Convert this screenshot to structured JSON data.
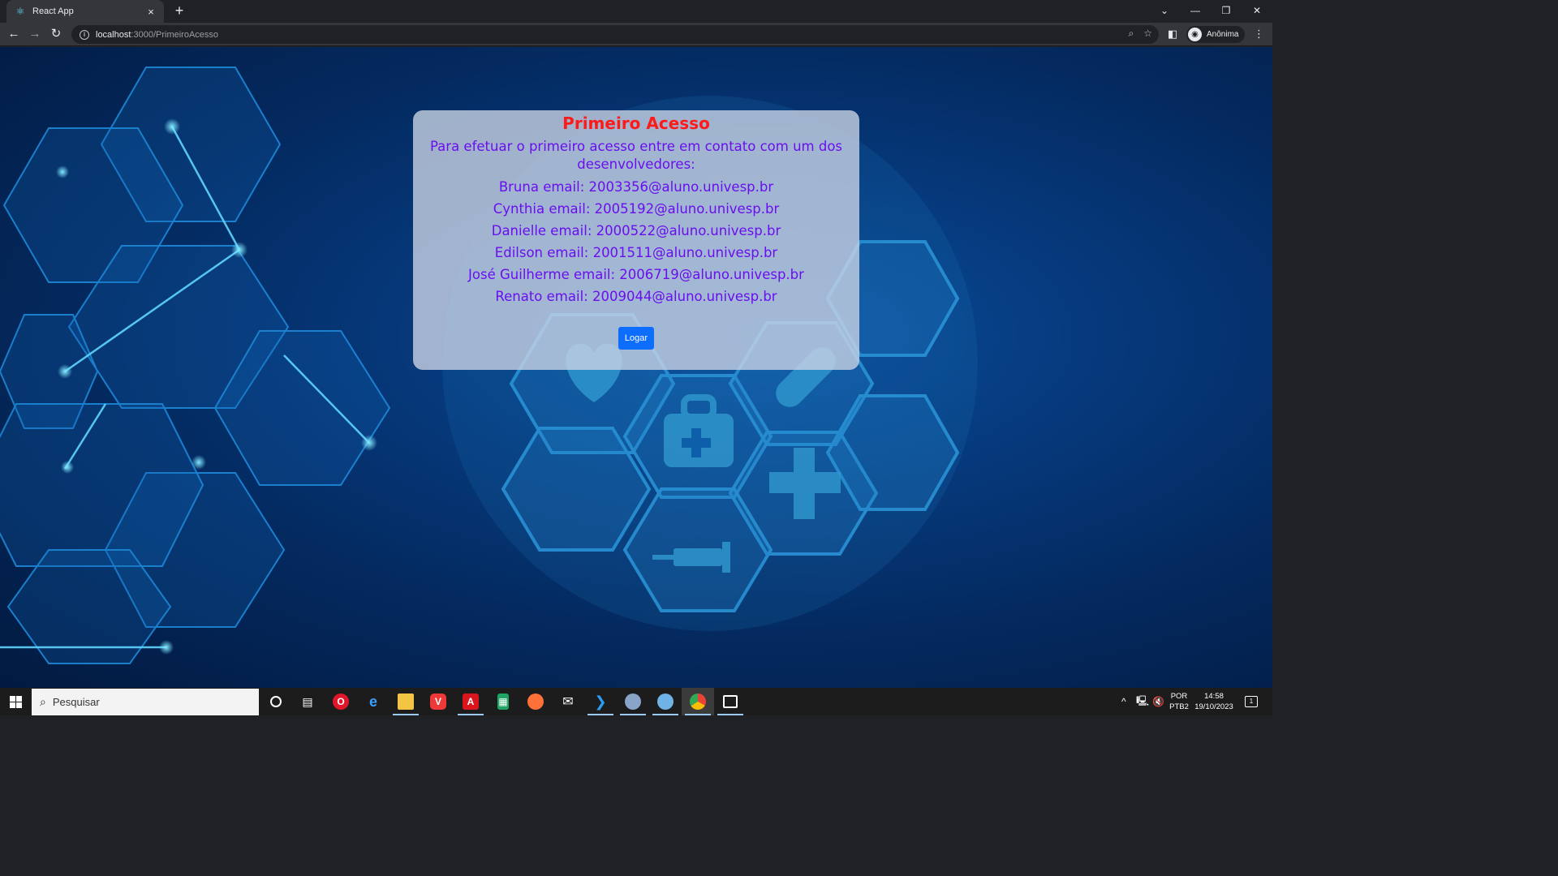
{
  "browser": {
    "tab_title": "React App",
    "tab_close": "×",
    "new_tab": "+",
    "url_host": "localhost",
    "url_path": ":3000/PrimeiroAcesso",
    "profile_label": "Anônima"
  },
  "page": {
    "title": "Primeiro Acesso",
    "intro": "Para efetuar o primeiro acesso entre em contato com um dos desenvolvedores:",
    "contacts": [
      "Bruna email: 2003356@aluno.univesp.br",
      "Cynthia email: 2005192@aluno.univesp.br",
      "Danielle email: 2000522@aluno.univesp.br",
      "Edilson email: 2001511@aluno.univesp.br",
      "José Guilherme email: 2006719@aluno.univesp.br",
      "Renato email: 2009044@aluno.univesp.br"
    ],
    "login_button": "Logar"
  },
  "taskbar": {
    "search_placeholder": "Pesquisar",
    "language_line1": "POR",
    "language_line2": "PTB2",
    "time": "14:58",
    "date": "19/10/2023",
    "notification_count": "1"
  },
  "colors": {
    "title": "#ff1a1a",
    "text": "#6a0ef0",
    "button": "#0d6efd"
  }
}
